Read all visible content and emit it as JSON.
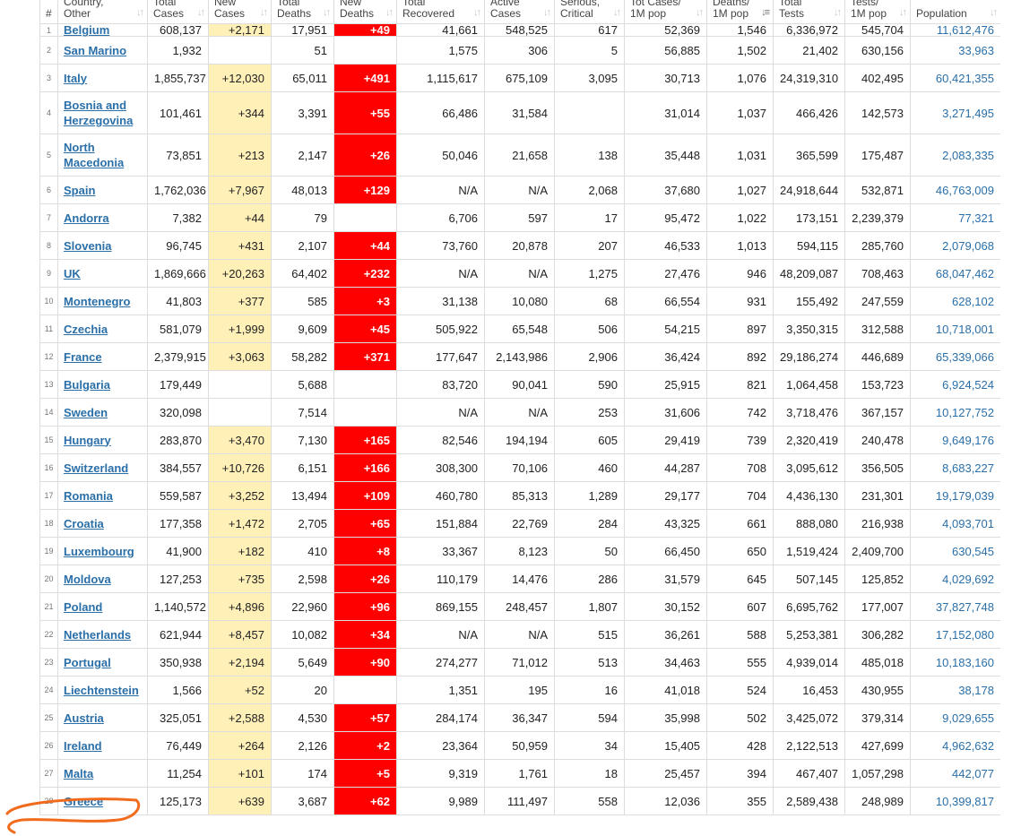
{
  "columns": [
    {
      "l1": "#",
      "l2": ""
    },
    {
      "l1": "Country,",
      "l2": "Other"
    },
    {
      "l1": "Total",
      "l2": "Cases"
    },
    {
      "l1": "New",
      "l2": "Cases"
    },
    {
      "l1": "Total",
      "l2": "Deaths"
    },
    {
      "l1": "New",
      "l2": "Deaths"
    },
    {
      "l1": "Total",
      "l2": "Recovered"
    },
    {
      "l1": "Active",
      "l2": "Cases"
    },
    {
      "l1": "Serious,",
      "l2": "Critical"
    },
    {
      "l1": "Tot Cases/",
      "l2": "1M pop"
    },
    {
      "l1": "Deaths/",
      "l2": "1M pop"
    },
    {
      "l1": "Total",
      "l2": "Tests"
    },
    {
      "l1": "Tests/",
      "l2": "1M pop"
    },
    {
      "l1": "",
      "l2": "Population"
    }
  ],
  "sort_icon": "↓↑",
  "sort_icon_active": "↓≡",
  "active_sort_column": "Deaths/ 1M pop",
  "colors": {
    "link": "#2a6fa8",
    "new_cases_bg": "#fff0b8",
    "new_deaths_bg": "#ff0000",
    "annotation": "#f26b1d"
  },
  "rows": [
    [
      "1",
      "Belgium",
      "608,137",
      "+2,171",
      "17,951",
      "+49",
      "41,661",
      "548,525",
      "617",
      "52,369",
      "1,546",
      "6,336,972",
      "545,704",
      "11,612,476"
    ],
    [
      "2",
      "San Marino",
      "1,932",
      "",
      "51",
      "",
      "1,575",
      "306",
      "5",
      "56,885",
      "1,502",
      "21,402",
      "630,156",
      "33,963"
    ],
    [
      "3",
      "Italy",
      "1,855,737",
      "+12,030",
      "65,011",
      "+491",
      "1,115,617",
      "675,109",
      "3,095",
      "30,713",
      "1,076",
      "24,319,310",
      "402,495",
      "60,421,355"
    ],
    [
      "4",
      "Bosnia and Herzegovina",
      "101,461",
      "+344",
      "3,391",
      "+55",
      "66,486",
      "31,584",
      "",
      "31,014",
      "1,037",
      "466,426",
      "142,573",
      "3,271,495"
    ],
    [
      "5",
      "North Macedonia",
      "73,851",
      "+213",
      "2,147",
      "+26",
      "50,046",
      "21,658",
      "138",
      "35,448",
      "1,031",
      "365,599",
      "175,487",
      "2,083,335"
    ],
    [
      "6",
      "Spain",
      "1,762,036",
      "+7,967",
      "48,013",
      "+129",
      "N/A",
      "N/A",
      "2,068",
      "37,680",
      "1,027",
      "24,918,644",
      "532,871",
      "46,763,009"
    ],
    [
      "7",
      "Andorra",
      "7,382",
      "+44",
      "79",
      "",
      "6,706",
      "597",
      "17",
      "95,472",
      "1,022",
      "173,151",
      "2,239,379",
      "77,321"
    ],
    [
      "8",
      "Slovenia",
      "96,745",
      "+431",
      "2,107",
      "+44",
      "73,760",
      "20,878",
      "207",
      "46,533",
      "1,013",
      "594,115",
      "285,760",
      "2,079,068"
    ],
    [
      "9",
      "UK",
      "1,869,666",
      "+20,263",
      "64,402",
      "+232",
      "N/A",
      "N/A",
      "1,275",
      "27,476",
      "946",
      "48,209,087",
      "708,463",
      "68,047,462"
    ],
    [
      "10",
      "Montenegro",
      "41,803",
      "+377",
      "585",
      "+3",
      "31,138",
      "10,080",
      "68",
      "66,554",
      "931",
      "155,492",
      "247,559",
      "628,102"
    ],
    [
      "11",
      "Czechia",
      "581,079",
      "+1,999",
      "9,609",
      "+45",
      "505,922",
      "65,548",
      "506",
      "54,215",
      "897",
      "3,350,315",
      "312,588",
      "10,718,001"
    ],
    [
      "12",
      "France",
      "2,379,915",
      "+3,063",
      "58,282",
      "+371",
      "177,647",
      "2,143,986",
      "2,906",
      "36,424",
      "892",
      "29,186,274",
      "446,689",
      "65,339,066"
    ],
    [
      "13",
      "Bulgaria",
      "179,449",
      "",
      "5,688",
      "",
      "83,720",
      "90,041",
      "590",
      "25,915",
      "821",
      "1,064,458",
      "153,723",
      "6,924,524"
    ],
    [
      "14",
      "Sweden",
      "320,098",
      "",
      "7,514",
      "",
      "N/A",
      "N/A",
      "253",
      "31,606",
      "742",
      "3,718,476",
      "367,157",
      "10,127,752"
    ],
    [
      "15",
      "Hungary",
      "283,870",
      "+3,470",
      "7,130",
      "+165",
      "82,546",
      "194,194",
      "605",
      "29,419",
      "739",
      "2,320,419",
      "240,478",
      "9,649,176"
    ],
    [
      "16",
      "Switzerland",
      "384,557",
      "+10,726",
      "6,151",
      "+166",
      "308,300",
      "70,106",
      "460",
      "44,287",
      "708",
      "3,095,612",
      "356,505",
      "8,683,227"
    ],
    [
      "17",
      "Romania",
      "559,587",
      "+3,252",
      "13,494",
      "+109",
      "460,780",
      "85,313",
      "1,289",
      "29,177",
      "704",
      "4,436,130",
      "231,301",
      "19,179,039"
    ],
    [
      "18",
      "Croatia",
      "177,358",
      "+1,472",
      "2,705",
      "+65",
      "151,884",
      "22,769",
      "284",
      "43,325",
      "661",
      "888,080",
      "216,938",
      "4,093,701"
    ],
    [
      "19",
      "Luxembourg",
      "41,900",
      "+182",
      "410",
      "+8",
      "33,367",
      "8,123",
      "50",
      "66,450",
      "650",
      "1,519,424",
      "2,409,700",
      "630,545"
    ],
    [
      "20",
      "Moldova",
      "127,253",
      "+735",
      "2,598",
      "+26",
      "110,179",
      "14,476",
      "286",
      "31,579",
      "645",
      "507,145",
      "125,852",
      "4,029,692"
    ],
    [
      "21",
      "Poland",
      "1,140,572",
      "+4,896",
      "22,960",
      "+96",
      "869,155",
      "248,457",
      "1,807",
      "30,152",
      "607",
      "6,695,762",
      "177,007",
      "37,827,748"
    ],
    [
      "22",
      "Netherlands",
      "621,944",
      "+8,457",
      "10,082",
      "+34",
      "N/A",
      "N/A",
      "515",
      "36,261",
      "588",
      "5,253,381",
      "306,282",
      "17,152,080"
    ],
    [
      "23",
      "Portugal",
      "350,938",
      "+2,194",
      "5,649",
      "+90",
      "274,277",
      "71,012",
      "513",
      "34,463",
      "555",
      "4,939,014",
      "485,018",
      "10,183,160"
    ],
    [
      "24",
      "Liechtenstein",
      "1,566",
      "+52",
      "20",
      "",
      "1,351",
      "195",
      "16",
      "41,018",
      "524",
      "16,453",
      "430,955",
      "38,178"
    ],
    [
      "25",
      "Austria",
      "325,051",
      "+2,588",
      "4,530",
      "+57",
      "284,174",
      "36,347",
      "594",
      "35,998",
      "502",
      "3,425,072",
      "379,314",
      "9,029,655"
    ],
    [
      "26",
      "Ireland",
      "76,449",
      "+264",
      "2,126",
      "+2",
      "23,364",
      "50,959",
      "34",
      "15,405",
      "428",
      "2,122,513",
      "427,699",
      "4,962,632"
    ],
    [
      "27",
      "Malta",
      "11,254",
      "+101",
      "174",
      "+5",
      "9,319",
      "1,761",
      "18",
      "25,457",
      "394",
      "467,407",
      "1,057,298",
      "442,077"
    ],
    [
      "28",
      "Greece",
      "125,173",
      "+639",
      "3,687",
      "+62",
      "9,989",
      "111,497",
      "558",
      "12,036",
      "355",
      "2,589,438",
      "248,989",
      "10,399,817"
    ]
  ]
}
